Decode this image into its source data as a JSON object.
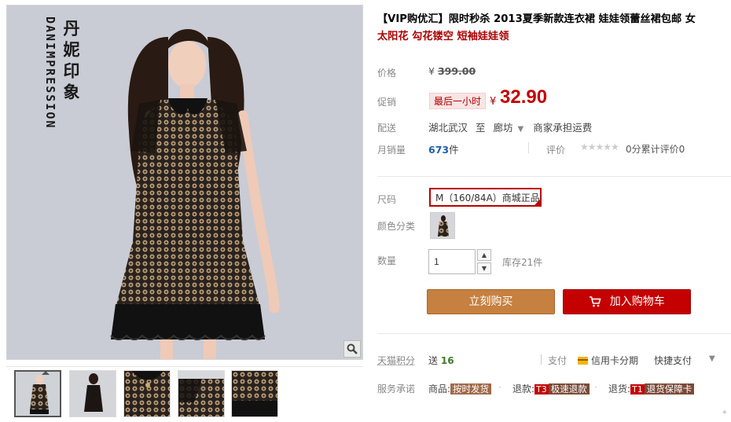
{
  "gallery": {
    "brand_en": "DANIMPRESSION",
    "brand_cn": "丹妮印象",
    "zoom_icon": "magnifier-icon",
    "thumbnails": [
      "thumb-1",
      "thumb-2",
      "thumb-3",
      "thumb-4",
      "thumb-5"
    ],
    "active_thumb": 0
  },
  "product": {
    "title_main": "【VIP购优汇】限时秒杀 2013夏季新款连衣裙 娃娃领蕾丝裙包邮 女",
    "title_tail": "太阳花 勾花镂空 短袖娃娃领"
  },
  "price": {
    "label": "价格",
    "currency": "¥",
    "original": "399.00",
    "promo_label": "促销",
    "promo_badge": "最后一小时",
    "current": "32.90"
  },
  "shipping": {
    "label": "配送",
    "from": "湖北武汉",
    "to_word": "至",
    "to": "廊坊",
    "fee_note": "商家承担运费"
  },
  "sales": {
    "label": "月销量",
    "count": "673",
    "unit": "件",
    "rating_label": "评价",
    "stars": "★★★★★",
    "score_text": "0分累计评价0"
  },
  "options": {
    "size_label": "尺码",
    "size_value": "M（160/84A）商城正品",
    "color_label": "颜色分类",
    "qty_label": "数量",
    "qty_value": "1",
    "stock_text": "库存21件",
    "step_up": "▲",
    "step_down": "▼"
  },
  "actions": {
    "buy_now": "立刻购买",
    "add_cart": "加入购物车"
  },
  "tmall": {
    "points_label": "天猫积分",
    "points_send_word": "送",
    "points_value": "16",
    "pay_label": "支付",
    "credit_label": "信用卡分期",
    "quick_pay": "快捷支付",
    "caret": "▼"
  },
  "service": {
    "label": "服务承诺",
    "goods_word": "商品:",
    "goods_tag": "按时发货",
    "refund_word": "退款:",
    "refund_t3": "T3",
    "refund_tag": "极速退款",
    "return_word": "退货:",
    "return_t1": "T1",
    "return_tag": "退货保障卡",
    "dot": "·"
  },
  "colors": {
    "price_red": "#c40000",
    "buy_button": "#c6803f",
    "cart_button": "#c40000"
  }
}
